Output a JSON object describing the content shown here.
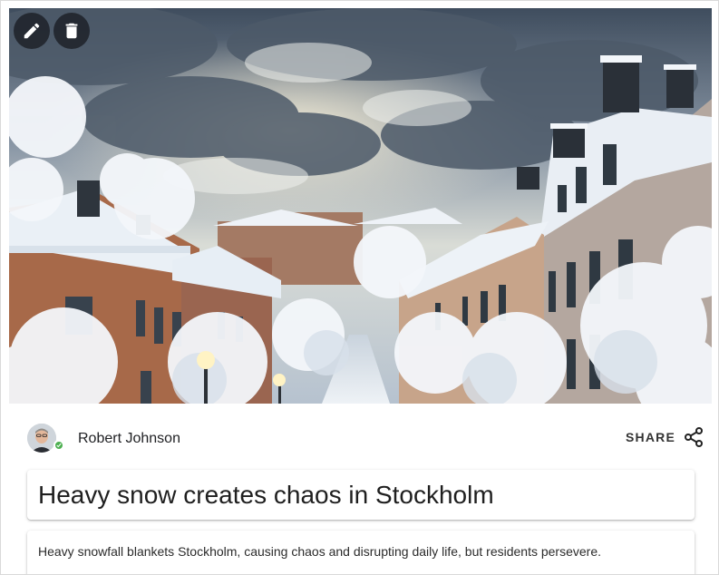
{
  "article": {
    "image_alt": "Snow-covered street in Stockholm with old buildings and frosted trees",
    "actions": {
      "edit_icon": "pencil-icon",
      "delete_icon": "trash-icon"
    },
    "author": {
      "name": "Robert Johnson",
      "status": "online",
      "status_color": "#4caf50"
    },
    "share": {
      "label": "SHARE",
      "icon": "share-icon"
    },
    "title": "Heavy snow creates chaos in Stockholm",
    "description": "Heavy snowfall blankets Stockholm, causing chaos and disrupting daily life, but residents persevere."
  }
}
